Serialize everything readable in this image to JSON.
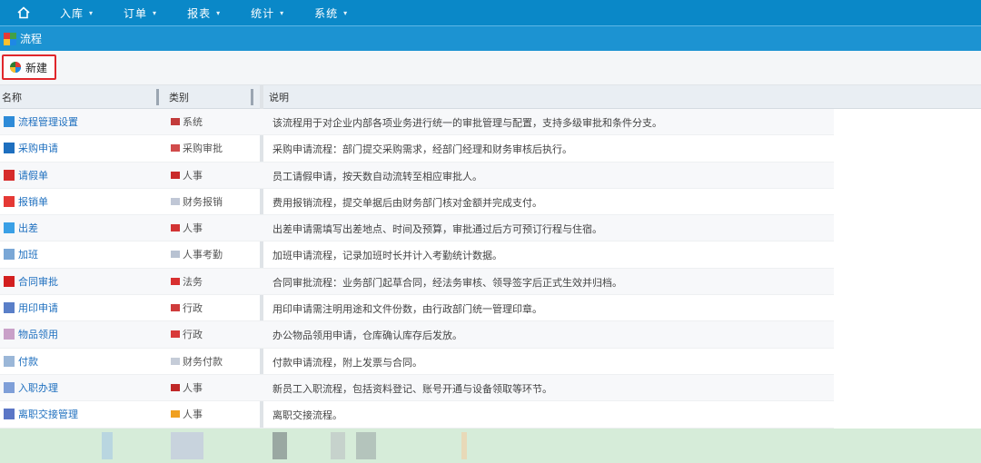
{
  "nav": {
    "home_icon": "home-icon",
    "items": [
      {
        "label": "入库"
      },
      {
        "label": "订单"
      },
      {
        "label": "报表"
      },
      {
        "label": "统计"
      },
      {
        "label": "系统"
      }
    ]
  },
  "subbar": {
    "title": "流程"
  },
  "toolbar": {
    "new_label": "新建"
  },
  "grid": {
    "headers": [
      "名称",
      "类别",
      "说明"
    ],
    "rows": [
      {
        "name": "流程管理设置",
        "category": "系统",
        "description": "该流程用于对企业内部各项业务进行统一的审批管理与配置，支持多级审批和条件分支。"
      },
      {
        "name": "采购申请",
        "category": "采购审批",
        "description": "采购申请流程：部门提交采购需求，经部门经理和财务审核后执行。"
      },
      {
        "name": "请假单",
        "category": "人事",
        "description": "员工请假申请，按天数自动流转至相应审批人。"
      },
      {
        "name": "报销单",
        "category": "财务报销",
        "description": "费用报销流程，提交单据后由财务部门核对金额并完成支付。"
      },
      {
        "name": "出差",
        "category": "人事",
        "description": "出差申请需填写出差地点、时间及预算，审批通过后方可预订行程与住宿。"
      },
      {
        "name": "加班",
        "category": "人事考勤",
        "description": "加班申请流程，记录加班时长并计入考勤统计数据。"
      },
      {
        "name": "合同审批",
        "category": "法务",
        "description": "合同审批流程：业务部门起草合同，经法务审核、领导签字后正式生效并归档。"
      },
      {
        "name": "用印申请",
        "category": "行政",
        "description": "用印申请需注明用途和文件份数，由行政部门统一管理印章。"
      },
      {
        "name": "物品领用",
        "category": "行政",
        "description": "办公物品领用申请，仓库确认库存后发放。"
      },
      {
        "name": "付款",
        "category": "财务付款",
        "description": "付款申请流程，附上发票与合同。"
      },
      {
        "name": "入职办理",
        "category": "人事",
        "description": "新员工入职流程，包括资料登记、账号开通与设备领取等环节。"
      },
      {
        "name": "离职交接管理",
        "category": "人事",
        "description": "离职交接流程。"
      }
    ]
  }
}
